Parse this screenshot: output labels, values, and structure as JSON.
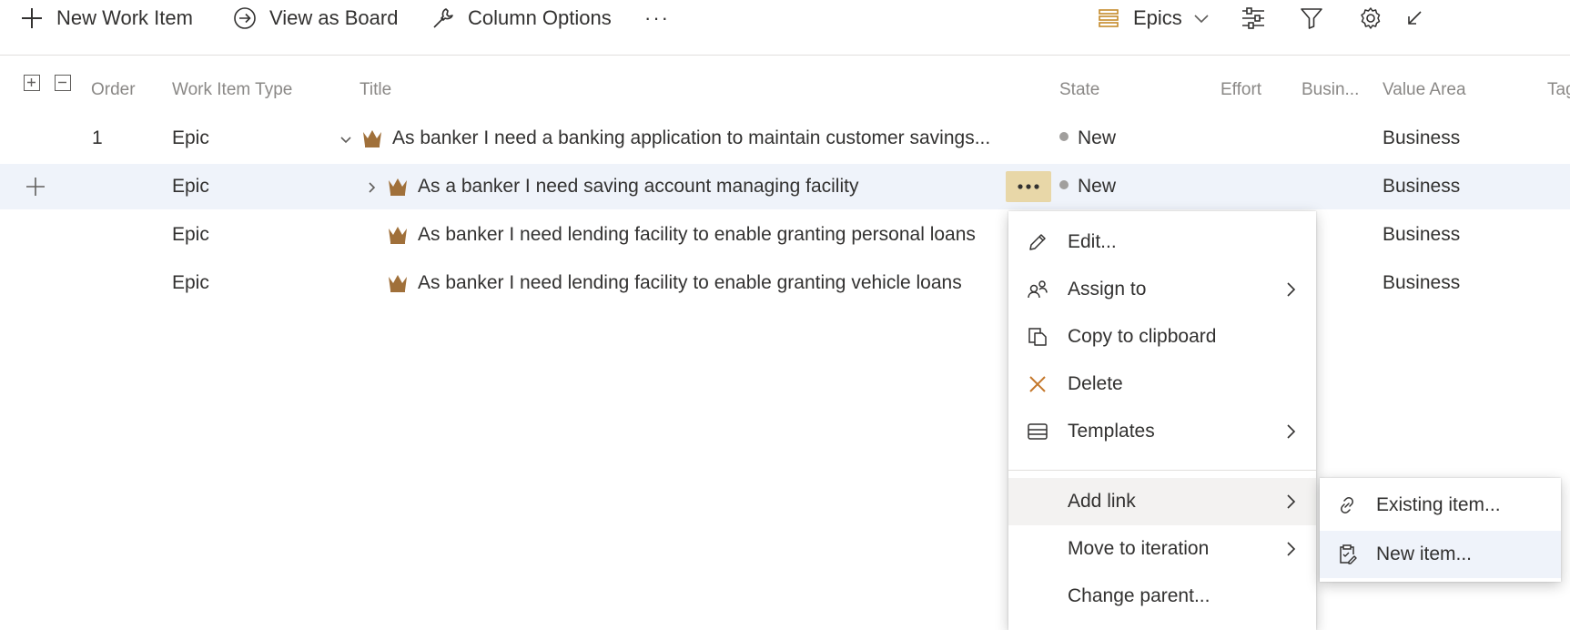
{
  "toolbar": {
    "new_work_item": "New Work Item",
    "view_as_board": "View as Board",
    "column_options": "Column Options",
    "more": "···",
    "backlog_level": "Epics"
  },
  "columns": {
    "order": "Order",
    "work_item_type": "Work Item Type",
    "title": "Title",
    "state": "State",
    "effort": "Effort",
    "business": "Busin...",
    "value_area": "Value Area",
    "tags": "Tags"
  },
  "rows": [
    {
      "order": "1",
      "type": "Epic",
      "title": "As banker I need a banking application to maintain customer savings...",
      "state": "New",
      "value_area": "Business"
    },
    {
      "order": "",
      "type": "Epic",
      "title": "As a banker I need saving account managing facility",
      "state": "New",
      "value_area": "Business"
    },
    {
      "order": "",
      "type": "Epic",
      "title": "As banker I need lending facility to enable granting personal loans",
      "state": "",
      "value_area": "Business"
    },
    {
      "order": "",
      "type": "Epic",
      "title": "As banker I need lending facility to enable granting vehicle loans",
      "state": "",
      "value_area": "Business"
    }
  ],
  "context_menu": {
    "edit": "Edit...",
    "assign_to": "Assign to",
    "copy_to_clipboard": "Copy to clipboard",
    "delete": "Delete",
    "templates": "Templates",
    "add_link": "Add link",
    "move_to_iteration": "Move to iteration",
    "change_parent": "Change parent..."
  },
  "submenu": {
    "existing_item": "Existing item...",
    "new_item": "New item..."
  },
  "colors": {
    "epic_icon": "#a0703a",
    "accent": "#0078d4",
    "selected_row": "#eff3fa",
    "more_button": "#e8d7a8"
  }
}
